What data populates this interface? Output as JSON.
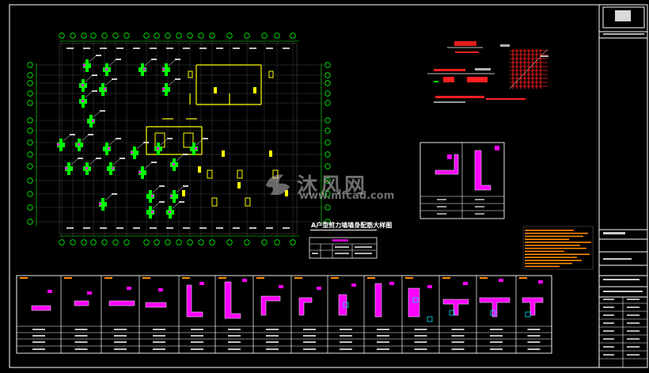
{
  "drawing": {
    "plan_title": "A户型剪力墙墙身配筋大样图",
    "watermark_text": "沐风网",
    "watermark_url": "www.mfcad.com",
    "colors": {
      "background": "#000000",
      "axis": "#00ff00",
      "wall": "#ffff00",
      "rebar": "#ff00ff",
      "line": "#ffffff",
      "note": "#ff8c00",
      "detail_red": "#ff2020",
      "dim": "#00e5ff"
    }
  }
}
